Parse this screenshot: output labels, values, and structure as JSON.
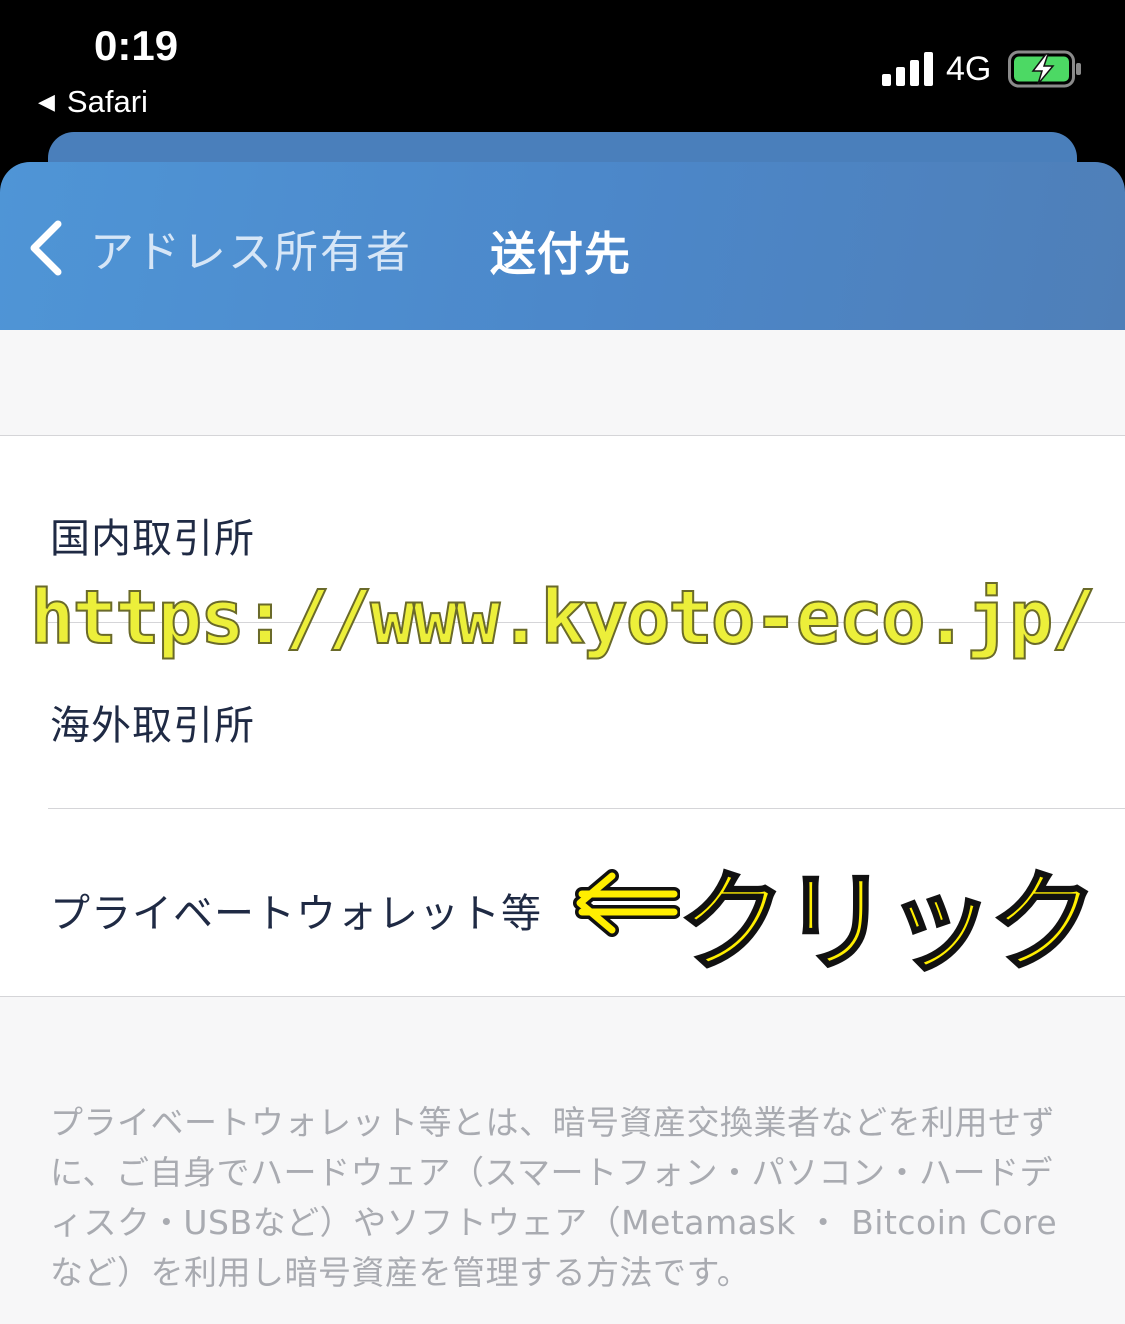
{
  "status_bar": {
    "time": "0:19",
    "back_app": "Safari",
    "network": "4G",
    "icons": [
      "signal-bars-icon",
      "battery-charging-icon"
    ]
  },
  "nav": {
    "back_label": "アドレス所有者",
    "title": "送付先",
    "gradient_colors": [
      "#4f95d6",
      "#4f7fb8"
    ]
  },
  "list": {
    "items": [
      {
        "label": "国内取引所"
      },
      {
        "label": "海外取引所"
      },
      {
        "label": "プライベートウォレット等"
      }
    ]
  },
  "footnote": "プライベートウォレット等とは、暗号資産交換業者などを利用せずに、ご自身でハードウェア（スマートフォン・パソコン・ハードディスク・USBなど）やソフトウェア（Metamask ・ Bitcoin Core など）を利用し暗号資産を管理する方法です。",
  "overlays": {
    "watermark": "https://www.kyoto-eco.jp/",
    "annotation": "クリック",
    "annotation_color": "#ffee00"
  }
}
